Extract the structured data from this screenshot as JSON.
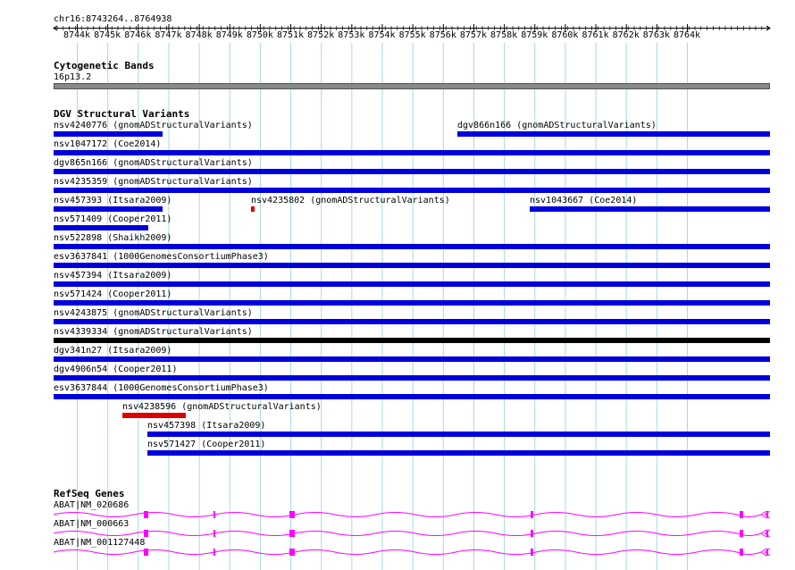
{
  "browser": {
    "position_label": "chr16:8743264..8764938",
    "ruler_ticks": [
      "8744k",
      "8745k",
      "8746k",
      "8747k",
      "8748k",
      "8749k",
      "8750k",
      "8751k",
      "8752k",
      "8753k",
      "8754k",
      "8755k",
      "8756k",
      "8757k",
      "8758k",
      "8759k",
      "8760k",
      "8761k",
      "8762k",
      "8763k",
      "8764k"
    ],
    "tracks": {
      "cytoband": {
        "title": "Cytogenetic Bands",
        "band_label": "16p13.2"
      },
      "dgv": {
        "title": "DGV Structural Variants",
        "variants": [
          {
            "label": "nsv4240776 (gnomADStructuralVariants)",
            "color": "#0000dd"
          },
          {
            "label": "dgv866n166 (gnomADStructuralVariants)",
            "color": "#0000dd"
          },
          {
            "label": "nsv1047172 (Coe2014)",
            "color": "#0000dd"
          },
          {
            "label": "dgv865n166 (gnomADStructuralVariants)",
            "color": "#0000dd"
          },
          {
            "label": "nsv4235359 (gnomADStructuralVariants)",
            "color": "#0000dd"
          },
          {
            "label": "nsv457393 (Itsara2009)",
            "color": "#0000dd"
          },
          {
            "label": "nsv4235802 (gnomADStructuralVariants)",
            "color": "#dd0000"
          },
          {
            "label": "nsv1043667 (Coe2014)",
            "color": "#0000dd"
          },
          {
            "label": "nsv571409 (Cooper2011)",
            "color": "#0000dd"
          },
          {
            "label": "nsv522898 (Shaikh2009)",
            "color": "#0000dd"
          },
          {
            "label": "esv3637841 (1000GenomesConsortiumPhase3)",
            "color": "#0000dd"
          },
          {
            "label": "nsv457394 (Itsara2009)",
            "color": "#0000dd"
          },
          {
            "label": "nsv571424 (Cooper2011)",
            "color": "#0000dd"
          },
          {
            "label": "nsv4243875 (gnomADStructuralVariants)",
            "color": "#0000dd"
          },
          {
            "label": "nsv4339334 (gnomADStructuralVariants)",
            "color": "#000000"
          },
          {
            "label": "dgv341n27 (Itsara2009)",
            "color": "#0000dd"
          },
          {
            "label": "dgv4906n54 (Cooper2011)",
            "color": "#0000dd"
          },
          {
            "label": "esv3637844 (1000GenomesConsortiumPhase3)",
            "color": "#0000dd"
          },
          {
            "label": "nsv4238596 (gnomADStructuralVariants)",
            "color": "#dd0000"
          },
          {
            "label": "nsv457398 (Itsara2009)",
            "color": "#0000dd"
          },
          {
            "label": "nsv571427 (Cooper2011)",
            "color": "#0000dd"
          }
        ]
      },
      "refseq": {
        "title": "RefSeq Genes",
        "color": "#ff00ff",
        "transcripts": [
          "ABAT|NM_020686",
          "ABAT|NM_000663",
          "ABAT|NM_001127448"
        ]
      }
    }
  }
}
